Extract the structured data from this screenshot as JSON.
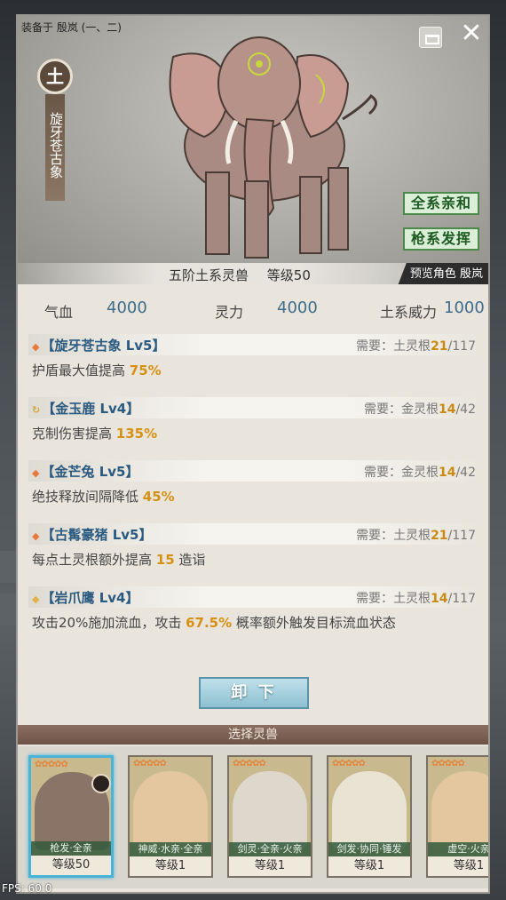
{
  "header": {
    "equipped_label": "装备于 殷岚 (一、二)"
  },
  "beast": {
    "element": "土",
    "name": "旋牙苍古象",
    "rank_text": "五阶土系灵兽",
    "level_text": "等级50"
  },
  "buttons": {
    "affinity": "全系亲和",
    "gun": "枪系发挥",
    "unload": "卸 下",
    "close": "✕"
  },
  "preview": {
    "label": "预览角色",
    "character": "殷岚"
  },
  "stats": [
    {
      "label": "气血",
      "value": "4000"
    },
    {
      "label": "灵力",
      "value": "4000"
    },
    {
      "label": "土系威力",
      "value": "1000"
    }
  ],
  "skills": [
    {
      "marker": "◆",
      "marker_color": "#e8793a",
      "title": "【旋牙苍古象 Lv5】",
      "req_label": "需要：",
      "req_root": "土灵根",
      "req_have": "21",
      "req_total": "/117",
      "desc_pre": "护盾最大值提高 ",
      "desc_hl": "75%",
      "desc_post": ""
    },
    {
      "marker": "↻",
      "marker_color": "#d4a93a",
      "title": "【金玉鹿 Lv4】",
      "req_label": "需要：",
      "req_root": "金灵根",
      "req_have": "14",
      "req_total": "/42",
      "desc_pre": "克制伤害提高 ",
      "desc_hl": "135%",
      "desc_post": ""
    },
    {
      "marker": "◆",
      "marker_color": "#e8793a",
      "title": "【金芒兔 Lv5】",
      "req_label": "需要：",
      "req_root": "金灵根",
      "req_have": "14",
      "req_total": "/42",
      "desc_pre": "绝技释放间隔降低 ",
      "desc_hl": "45%",
      "desc_post": ""
    },
    {
      "marker": "◆",
      "marker_color": "#e8793a",
      "title": "【古髯豪猪 Lv5】",
      "req_label": "需要：",
      "req_root": "土灵根",
      "req_have": "21",
      "req_total": "/117",
      "desc_pre": "每点土灵根额外提高 ",
      "desc_hl": "15",
      "desc_post": " 造诣"
    },
    {
      "marker": "◆",
      "marker_color": "#e3b246",
      "title": "【岩爪鹰 Lv4】",
      "req_label": "需要：",
      "req_root": "土灵根",
      "req_have": "14",
      "req_total": "/117",
      "desc_pre": "攻击20%施加流血，攻击 ",
      "desc_hl": "67.5%",
      "desc_post": " 概率额外触发目标流血状态"
    }
  ],
  "select_title": "选择灵兽",
  "cards": [
    {
      "stars": "✿✿✿✿✿",
      "type": "枪发·全亲",
      "level": "等级50",
      "art_color": "#8a7468"
    },
    {
      "stars": "✿✿✿✿✿",
      "type": "神威·水亲·全亲",
      "level": "等级1",
      "art_color": "#e4c79e"
    },
    {
      "stars": "✿✿✿✿✿",
      "type": "剑灵·全亲·火亲",
      "level": "等级1",
      "art_color": "#ddd8cb"
    },
    {
      "stars": "✿✿✿✿✿",
      "type": "剑发·协同·锤发",
      "level": "等级1",
      "art_color": "#e8e3d3"
    },
    {
      "stars": "✿✿✿✿✿",
      "type": "虚空·火亲",
      "level": "等级1",
      "art_color": "#e4c79e"
    }
  ],
  "fps": "FPS: 60.0"
}
